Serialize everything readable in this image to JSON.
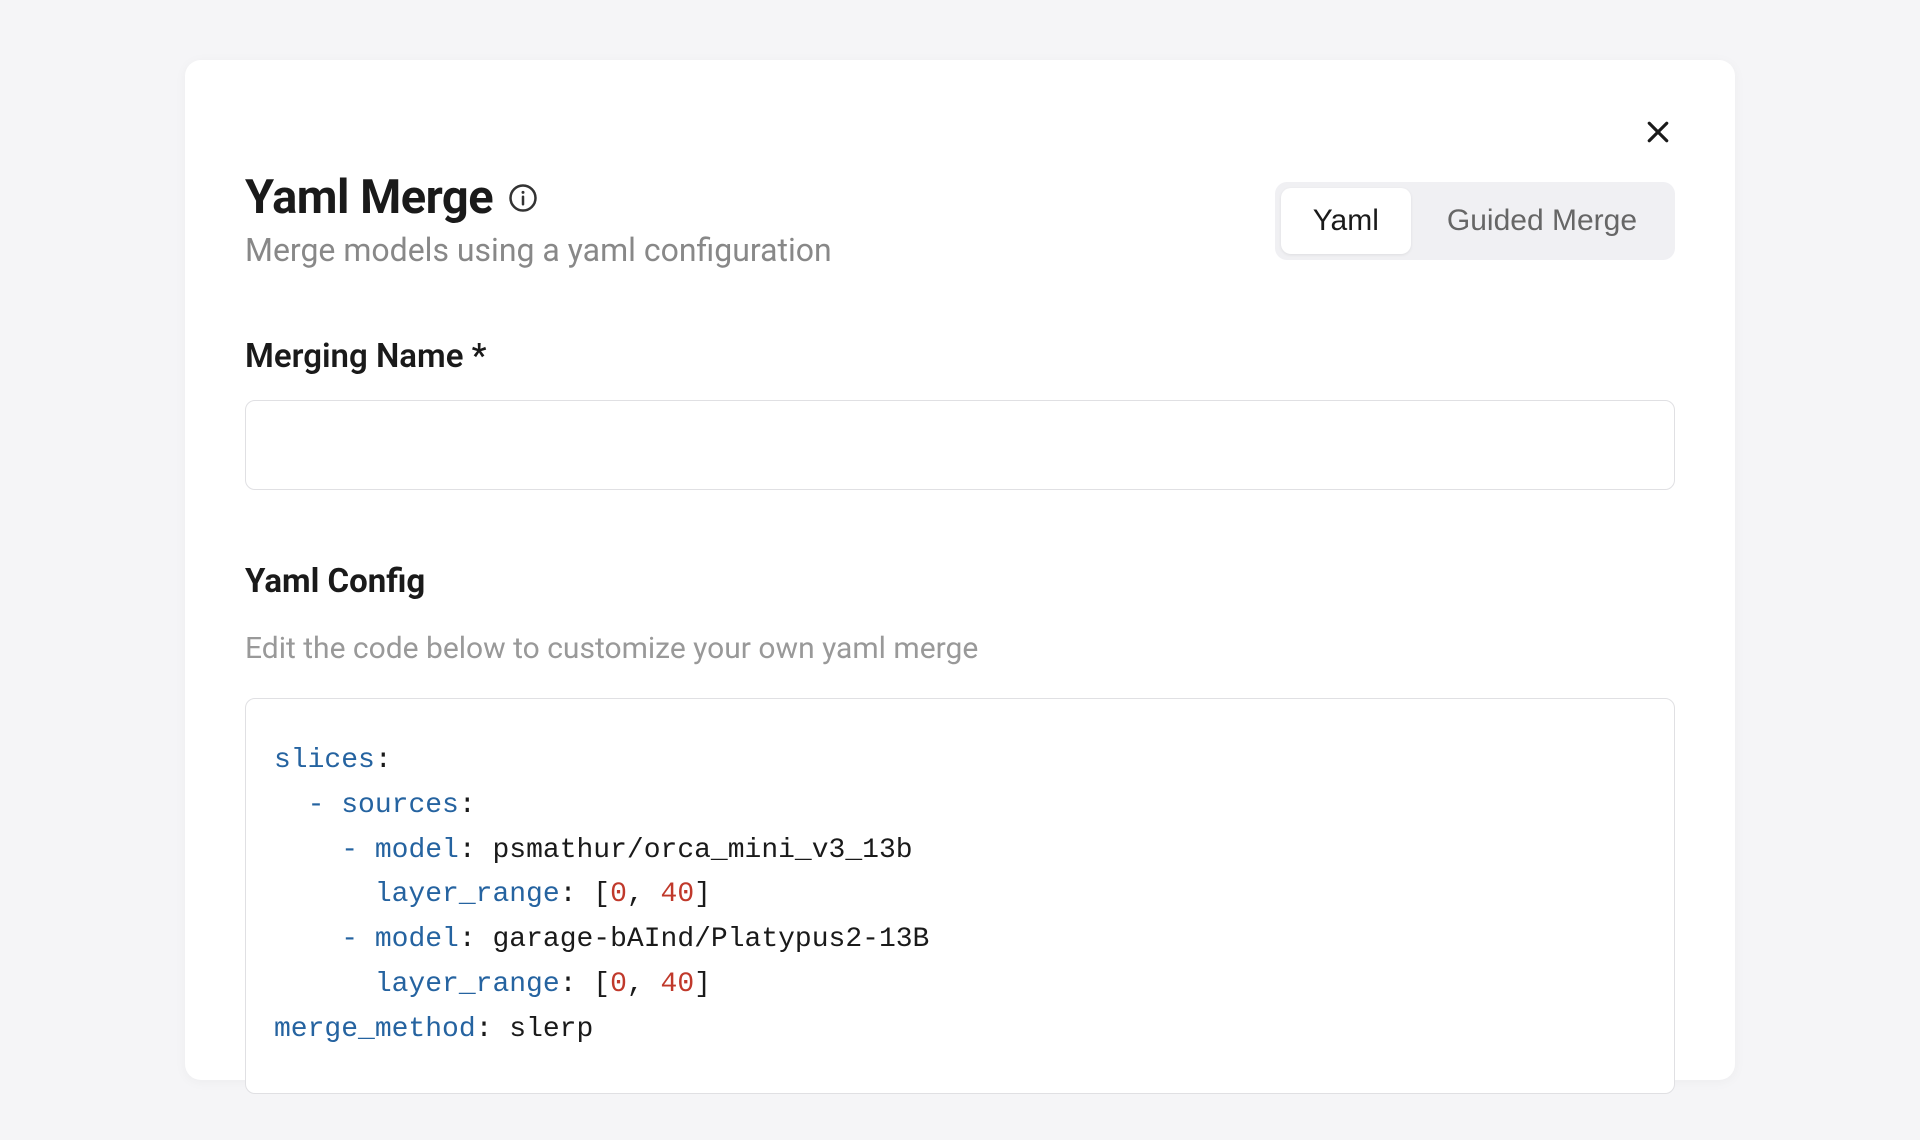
{
  "modal": {
    "title": "Yaml Merge",
    "subtitle": "Merge models using a yaml configuration",
    "tabs": {
      "yaml": "Yaml",
      "guided": "Guided Merge"
    },
    "merging_name_label": "Merging Name *",
    "merging_name_value": "",
    "yaml_config_heading": "Yaml Config",
    "yaml_config_helper": "Edit the code below to customize your own yaml merge",
    "yaml": {
      "line1_key": "slices",
      "line2_key": "sources",
      "line3_key": "model",
      "line3_val": "psmathur/orca_mini_v3_13b",
      "line4_key": "layer_range",
      "line4_n1": "0",
      "line4_n2": "40",
      "line5_key": "model",
      "line5_val": "garage-bAInd/Platypus2-13B",
      "line6_key": "layer_range",
      "line6_n1": "0",
      "line6_n2": "40",
      "line7_key": "merge_method",
      "line7_val": "slerp"
    }
  }
}
